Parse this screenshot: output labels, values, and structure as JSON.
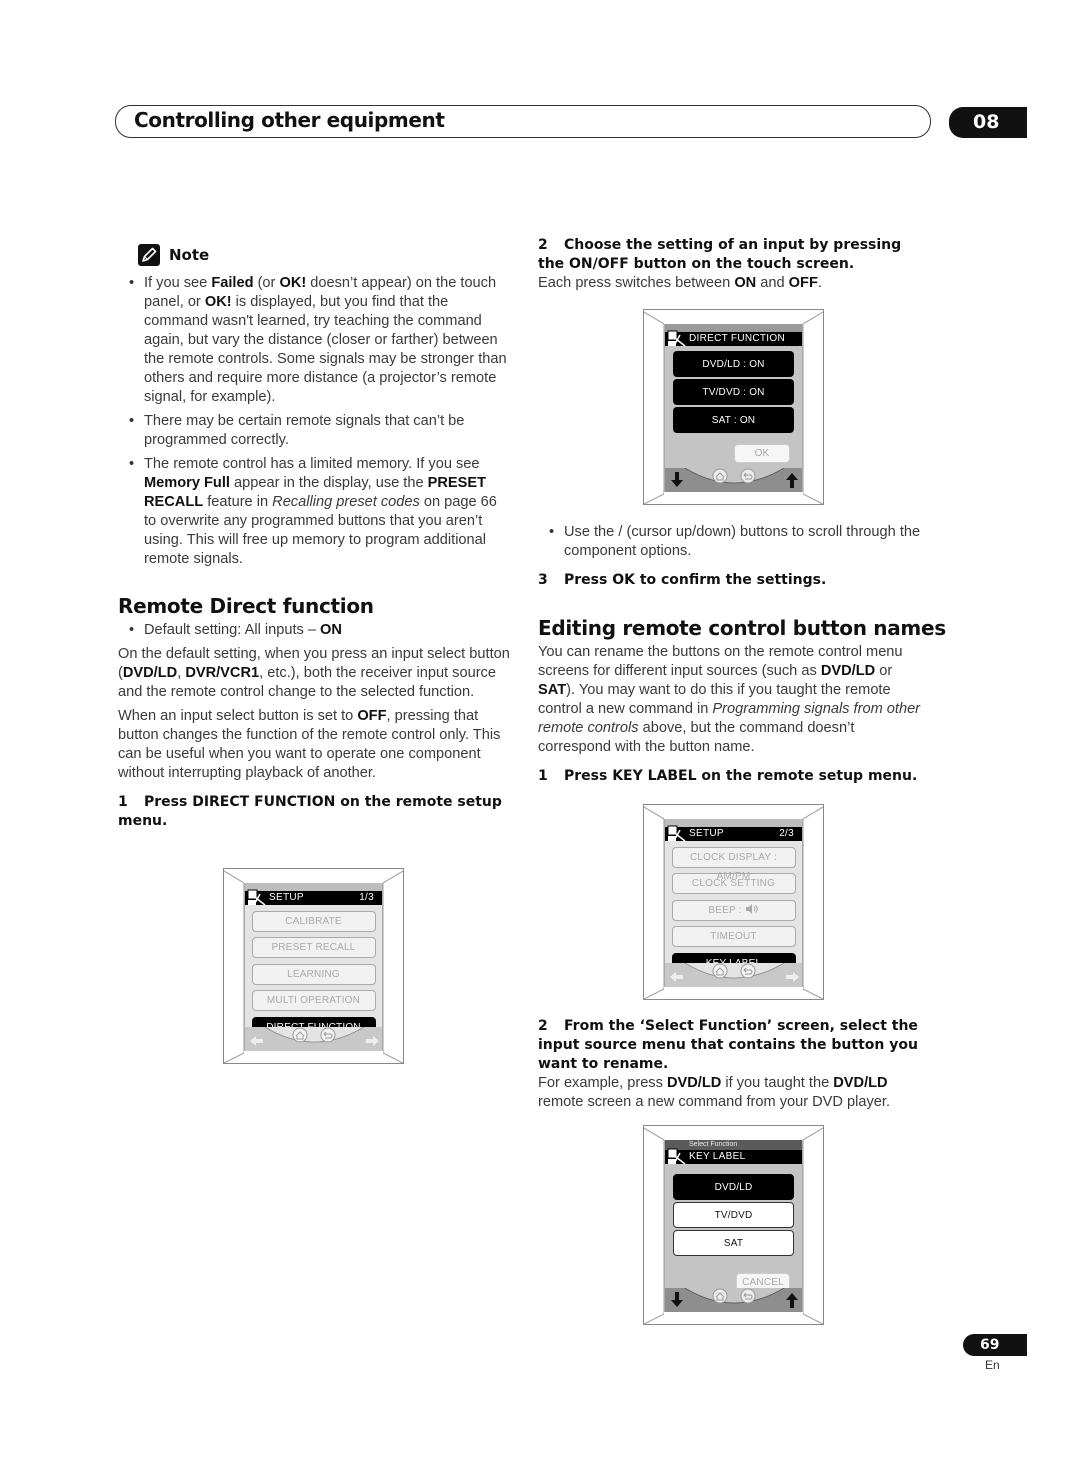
{
  "header": {
    "chapter_title": "Controlling other equipment",
    "chapter_number": "08"
  },
  "note": {
    "icon": "pencil-note-icon",
    "label": "Note",
    "items": [
      {
        "parts": [
          {
            "t": "If you see "
          },
          {
            "b": "Failed"
          },
          {
            "t": " (or "
          },
          {
            "b": "OK!"
          },
          {
            "t": " doesn’t appear) on the touch panel, or "
          },
          {
            "b": "OK!"
          },
          {
            "t": " is displayed, but you find that the command wasn't learned, try teaching the command again, but vary the distance (closer or farther) between the remote controls. Some signals may be stronger than others and require more distance (a projector’s remote signal, for example)."
          }
        ]
      },
      {
        "parts": [
          {
            "t": "There may be certain remote signals that can’t be programmed correctly."
          }
        ]
      },
      {
        "parts": [
          {
            "t": "The remote control has a limited memory. If you see "
          },
          {
            "b": "Memory Full"
          },
          {
            "t": " appear in the display, use the "
          },
          {
            "b": "PRESET RECALL"
          },
          {
            "t": " feature in "
          },
          {
            "i": "Recalling preset codes"
          },
          {
            "t": " on page 66 to overwrite any programmed buttons that you aren’t using. This will free up memory to program additional remote signals."
          }
        ]
      }
    ]
  },
  "remote_direct": {
    "title": "Remote Direct function",
    "default_setting": [
      {
        "t": "Default setting: All inputs – "
      },
      {
        "b": "ON"
      }
    ],
    "para1": [
      {
        "t": "On the default setting, when you press an input select button ("
      },
      {
        "b": "DVD/LD"
      },
      {
        "t": ", "
      },
      {
        "b": "DVR/VCR1"
      },
      {
        "t": ", etc.), both the receiver input source and the remote control change to the selected function."
      }
    ],
    "para2": [
      {
        "t": "When an input select button is set to "
      },
      {
        "b": "OFF"
      },
      {
        "t": ", pressing that button changes the function of the remote control only. This can be useful when you want to operate one component without interrupting playback of another."
      }
    ],
    "step1": {
      "num": "1",
      "text": "Press DIRECT FUNCTION on the remote setup menu."
    },
    "screen1": {
      "title": "SETUP",
      "page": "1/3",
      "buttons": [
        "CALIBRATE",
        "PRESET RECALL",
        "LEARNING",
        "MULTI OPERATION",
        "DIRECT FUNCTION"
      ],
      "selected_index": 4
    },
    "step2": {
      "num": "2",
      "text": "Choose the setting of an input by pressing the ON/OFF button on the touch screen."
    },
    "step2_body": [
      {
        "t": "Each press switches between "
      },
      {
        "b": "ON"
      },
      {
        "t": " and "
      },
      {
        "b": "OFF"
      },
      {
        "t": "."
      }
    ],
    "screen2": {
      "title": "DIRECT FUNCTION",
      "buttons": [
        "DVD/LD : ON",
        "TV/DVD : ON",
        "SAT : ON"
      ],
      "ok_label": "OK"
    },
    "cursor_bullet": [
      {
        "t": "Use the     /     (cursor up/down) buttons to scroll through the component options."
      }
    ],
    "step3": {
      "num": "3",
      "text": "Press OK to confirm the settings."
    }
  },
  "editing": {
    "title": "Editing remote control button names",
    "para": [
      {
        "t": "You can rename the buttons on the remote control menu screens for different input sources (such as "
      },
      {
        "b": "DVD/LD"
      },
      {
        "t": " or "
      },
      {
        "b": "SAT"
      },
      {
        "t": "). You may want to do this if you taught the remote control a new command in "
      },
      {
        "i": "Programming signals from other remote controls"
      },
      {
        "t": " above, but the command doesn’t correspond with the button name."
      }
    ],
    "step1": {
      "num": "1",
      "text": "Press KEY LABEL on the remote setup menu."
    },
    "screen3": {
      "title": "SETUP",
      "page": "2/3",
      "buttons": [
        "CLOCK DISPLAY : AM/PM",
        "CLOCK SETTING",
        "BEEP :",
        "TIMEOUT",
        "KEY LABEL"
      ],
      "beep_icon": "speaker-icon",
      "selected_index": 4
    },
    "step2": {
      "num": "2",
      "text": "From the ‘Select Function’ screen, select the input source menu that contains the button you want to rename."
    },
    "step2_body": [
      {
        "t": "For example, press "
      },
      {
        "b": "DVD/LD"
      },
      {
        "t": " if you taught the "
      },
      {
        "b": "DVD/LD"
      },
      {
        "t": " remote screen a new command from your DVD player."
      }
    ],
    "screen4": {
      "subtitle": "Select Function",
      "title": "KEY LABEL",
      "buttons": [
        "DVD/LD",
        "TV/DVD",
        "SAT"
      ],
      "selected_index": 0,
      "cancel_label": "CANCEL"
    }
  },
  "footer": {
    "page_number": "69",
    "language": "En"
  }
}
